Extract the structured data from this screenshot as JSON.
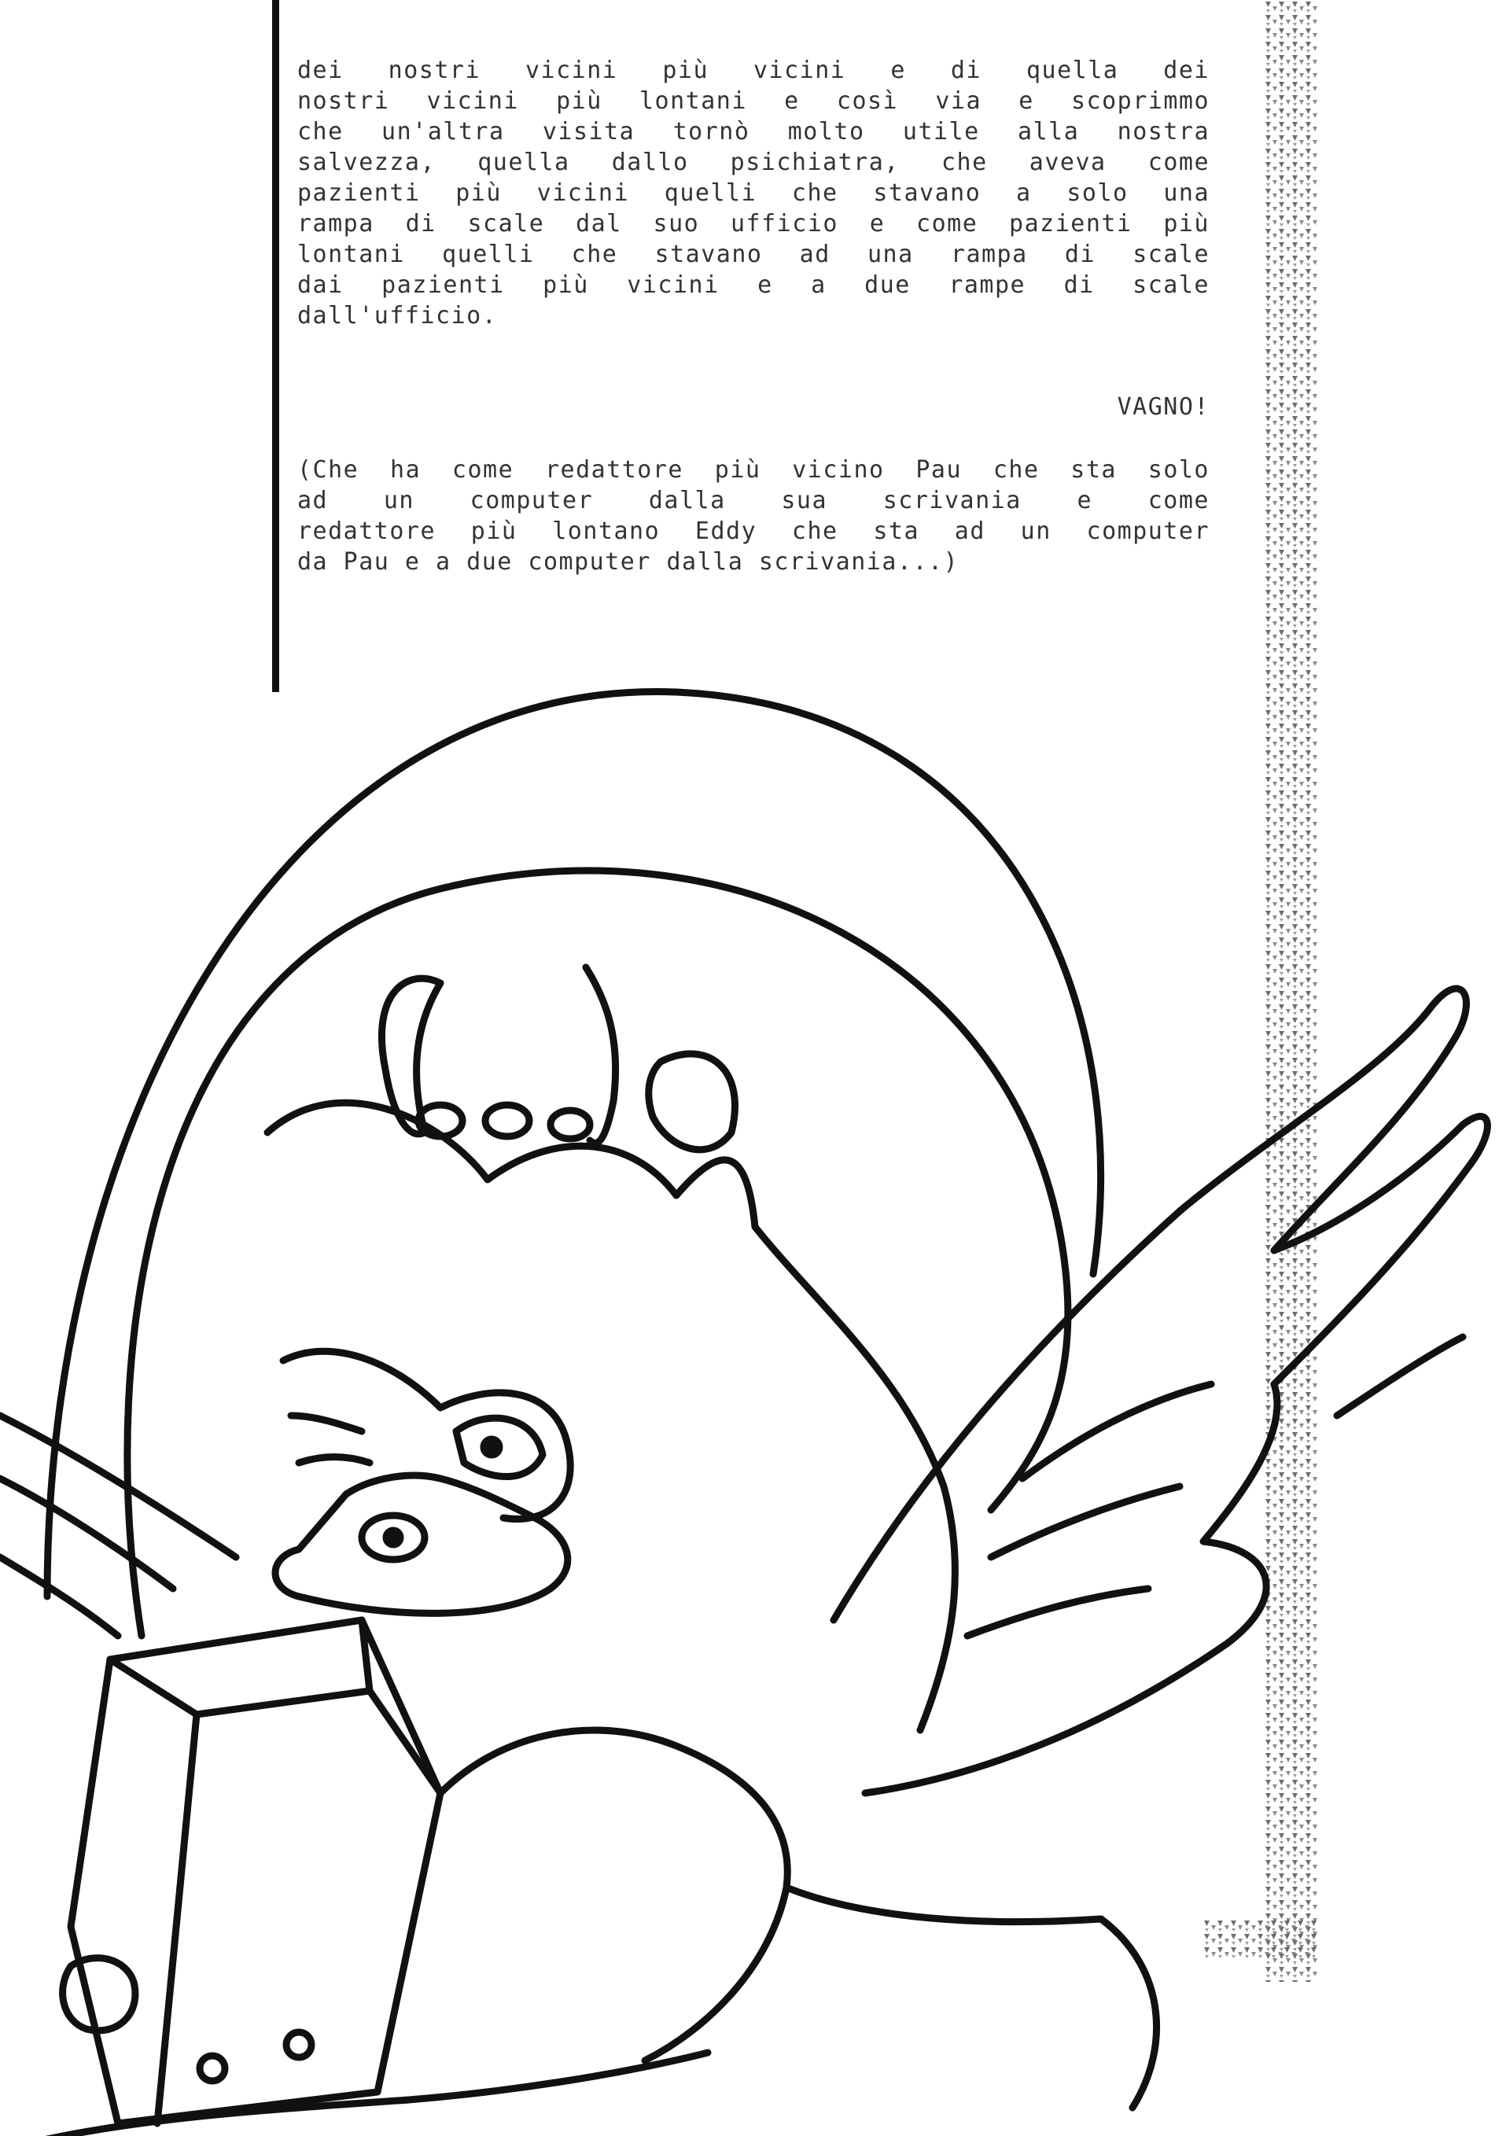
{
  "document": {
    "paragraph_lines": [
      "dei nostri vicini più vicini e di quella dei",
      "nostri vicini più lontani e così via e scoprimmo",
      "che un'altra visita tornò molto utile alla nostra",
      "salvezza, quella dallo psichiatra, che aveva come",
      "pazienti più vicini quelli che stavano a solo una",
      "rampa di scale dal suo ufficio e come pazienti più",
      "lontani quelli che stavano ad una rampa di scale",
      "dai pazienti più vicini e a due rampe di scale",
      "dall'ufficio."
    ],
    "signature": "VAGNO!",
    "note_lines": [
      "(Che ha come redattore più vicino Pau che sta solo",
      "ad un computer dalla sua scrivania e come",
      "redattore più lontano Eddy che sta ad un computer",
      "da Pau e a due computer dalla scrivania...)"
    ]
  },
  "colors": {
    "ink": "#111111",
    "paper": "#ffffff",
    "text": "#333333"
  }
}
